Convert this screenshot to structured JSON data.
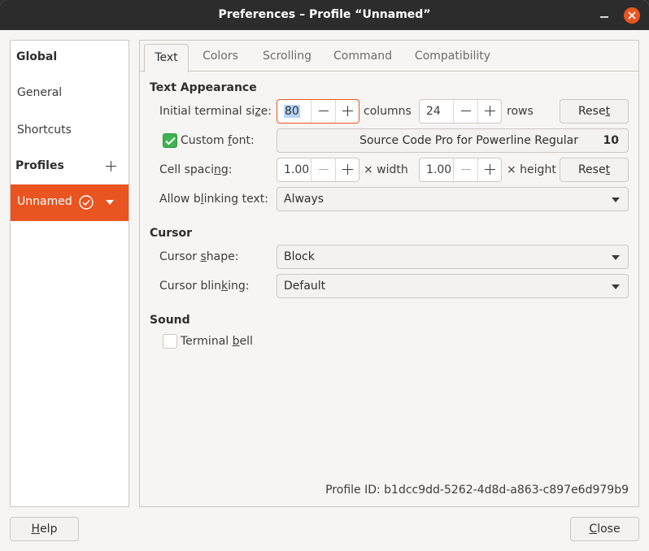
{
  "window": {
    "title": "Preferences – Profile “Unnamed”"
  },
  "sidebar": {
    "global_heading": "Global",
    "items": [
      {
        "label": "General"
      },
      {
        "label": "Shortcuts"
      }
    ],
    "profiles_heading": "Profiles",
    "profiles": [
      {
        "label": "Unnamed",
        "selected": true,
        "is_default": true
      }
    ]
  },
  "tabs": [
    {
      "label": "Text",
      "active": true
    },
    {
      "label": "Colors",
      "active": false
    },
    {
      "label": "Scrolling",
      "active": false
    },
    {
      "label": "Command",
      "active": false
    },
    {
      "label": "Compatibility",
      "active": false
    }
  ],
  "text_appearance": {
    "heading": "Text Appearance",
    "terminal_size": {
      "label_pre": "Initial terminal si",
      "label_u": "z",
      "label_post": "e:",
      "columns_value": "80",
      "columns_unit": "columns",
      "rows_value": "24",
      "rows_unit": "rows",
      "reset_pre": "Rese",
      "reset_u": "t"
    },
    "custom_font": {
      "label_pre": "Custom ",
      "label_u": "f",
      "label_post": "ont:",
      "checked": true,
      "font_name": "Source Code Pro for Powerline Regular",
      "font_size": "10"
    },
    "cell_spacing": {
      "label_pre": "Cell spaci",
      "label_u": "n",
      "label_post": "g:",
      "width_value": "1.00",
      "width_unit": "× width",
      "height_value": "1.00",
      "height_unit": "× height",
      "reset_pre": "Rese",
      "reset_u": "t"
    },
    "blinking_text": {
      "label_pre": "Allow b",
      "label_u": "l",
      "label_post": "inking text:",
      "value": "Always"
    }
  },
  "cursor": {
    "heading": "Cursor",
    "shape": {
      "label_pre": "Cursor ",
      "label_u": "s",
      "label_post": "hape:",
      "value": "Block"
    },
    "blinking": {
      "label_pre": "Cursor blin",
      "label_u": "k",
      "label_post": "ing:",
      "value": "Default"
    }
  },
  "sound": {
    "heading": "Sound",
    "bell": {
      "label_pre": "Terminal ",
      "label_u": "b",
      "label_post": "ell",
      "checked": false
    }
  },
  "profile_id": "Profile ID:  b1dcc9dd-5262-4d8d-a863-c897e6d979b9",
  "footer": {
    "help_pre": "",
    "help_u": "H",
    "help_post": "elp",
    "close_pre": "",
    "close_u": "C",
    "close_post": "lose"
  },
  "colors": {
    "accent": "#e95420",
    "check_green": "#3eb34f",
    "titlebar": "#2c2c2c",
    "window_bg": "#f6f5f4"
  },
  "icons": [
    "minimize-icon",
    "close-icon",
    "add-icon",
    "default-profile-check-icon",
    "dropdown-arrow-icon",
    "checkmark-icon",
    "minus-icon",
    "plus-icon"
  ]
}
